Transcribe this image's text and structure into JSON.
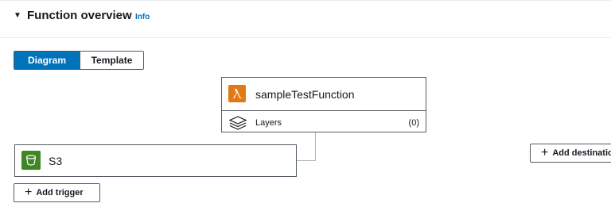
{
  "overview": {
    "title": "Function overview",
    "info_label": "Info",
    "caret": "▼"
  },
  "view_toggle": {
    "options": [
      {
        "label": "Diagram",
        "selected": true
      },
      {
        "label": "Template",
        "selected": false
      }
    ]
  },
  "function": {
    "name": "sampleTestFunction",
    "icon": "lambda-icon",
    "layers_label": "Layers",
    "layers_count": "(0)"
  },
  "trigger": {
    "name": "S3",
    "icon": "s3-bucket-icon"
  },
  "buttons": {
    "add_trigger": "Add trigger",
    "add_destination": "Add destination",
    "plus": "+"
  },
  "colors": {
    "accent": "#0073bb",
    "lambda": "#e07a15",
    "s3": "#3f8624"
  }
}
